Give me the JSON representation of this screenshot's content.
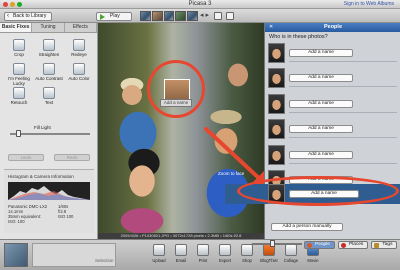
{
  "window": {
    "title": "Picasa 3",
    "sign_in": "Sign in to Web Albums"
  },
  "toolbar": {
    "back_label": "Back to Library",
    "play_label": "Play"
  },
  "left_panel": {
    "tabs": [
      {
        "label": "Basic Fixes",
        "active": true
      },
      {
        "label": "Tuning",
        "active": false
      },
      {
        "label": "Effects",
        "active": false
      }
    ],
    "tools": [
      {
        "label": "Crop"
      },
      {
        "label": "Straighten"
      },
      {
        "label": "Redeye"
      },
      {
        "label": "I'm Feeling Lucky"
      },
      {
        "label": "Auto Contrast"
      },
      {
        "label": "Auto Color"
      },
      {
        "label": "Retouch"
      },
      {
        "label": "Text"
      }
    ],
    "fill_light_label": "Fill Light",
    "fill_light_level": 0.1,
    "undo_label": "Undo",
    "redo_label": "Redo",
    "histogram_label": "Histogram & Camera Information",
    "camera_left": [
      "Panasonic DMC-LX2",
      "14.1mm",
      "35mm equivalent:",
      "ISO: 100"
    ],
    "camera_right": [
      "1/60s",
      "f/2.8",
      "ISO 100"
    ]
  },
  "photo": {
    "face_tag_label": "Add a name",
    "zoom_tip": "Zoom to face",
    "info_bar": "2009/4/26 • P1030601.JPG • 3072x1728 pixels • 2.3MB • 1/60s f/2.8"
  },
  "people_panel": {
    "title": "People",
    "question": "Who is in these photos?",
    "rows": [
      {
        "button_label": "Add a name",
        "selected": false
      },
      {
        "button_label": "Add a name",
        "selected": false
      },
      {
        "button_label": "Add a name",
        "selected": false
      },
      {
        "button_label": "Add a name",
        "selected": false
      },
      {
        "button_label": "Add a name",
        "selected": false
      },
      {
        "button_label": "Add a name",
        "selected": false
      },
      {
        "button_label": "Add a name",
        "selected": true
      }
    ],
    "add_manual_label": "Add a person manually"
  },
  "tray": {
    "selected_label": "Selection",
    "buttons": [
      {
        "label": "Upload",
        "icon": "upload-icon"
      },
      {
        "label": "Email",
        "icon": "email-icon"
      },
      {
        "label": "Print",
        "icon": "print-icon"
      },
      {
        "label": "Export",
        "icon": "export-icon"
      },
      {
        "label": "Shop",
        "icon": "shop-icon"
      },
      {
        "label": "BlogThis!",
        "icon": "blogger-icon"
      },
      {
        "label": "Collage",
        "icon": "collage-icon"
      },
      {
        "label": "Movie",
        "icon": "movie-icon"
      }
    ],
    "panel_tabs": [
      {
        "label": "People",
        "active": true
      },
      {
        "label": "Places",
        "active": false
      },
      {
        "label": "Tags",
        "active": false
      }
    ]
  },
  "colors": {
    "highlight": "#e8472f",
    "selection": "#2f5d92",
    "panel_header": "#3a6bb0"
  }
}
